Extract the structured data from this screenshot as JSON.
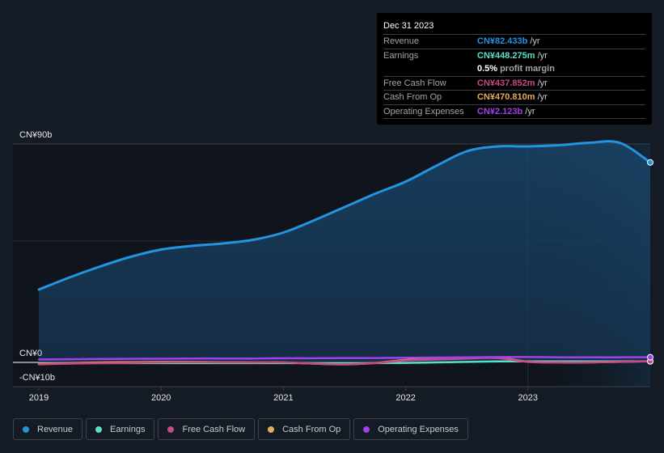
{
  "tooltip": {
    "date": "Dec 31 2023",
    "rows": [
      {
        "label": "Revenue",
        "value": "CN¥82.433b",
        "unit": "/yr",
        "color": "#2394df"
      },
      {
        "label": "Earnings",
        "value": "CN¥448.275m",
        "unit": "/yr",
        "color": "#57e0c8"
      },
      {
        "label": "",
        "value": "0.5%",
        "unit": "profit margin",
        "color": "#ffffff"
      },
      {
        "label": "Free Cash Flow",
        "value": "CN¥437.852m",
        "unit": "/yr",
        "color": "#c8488a"
      },
      {
        "label": "Cash From Op",
        "value": "CN¥470.810m",
        "unit": "/yr",
        "color": "#e8a95c"
      },
      {
        "label": "Operating Expenses",
        "value": "CN¥2.123b",
        "unit": "/yr",
        "color": "#a040ef"
      }
    ]
  },
  "legend": [
    {
      "label": "Revenue",
      "color": "#2394df"
    },
    {
      "label": "Earnings",
      "color": "#57e0c8"
    },
    {
      "label": "Free Cash Flow",
      "color": "#c8488a"
    },
    {
      "label": "Cash From Op",
      "color": "#e8a95c"
    },
    {
      "label": "Operating Expenses",
      "color": "#a040ef"
    }
  ],
  "chart_data": {
    "type": "area",
    "title": "",
    "xlabel": "",
    "ylabel": "",
    "ylim": [
      -10,
      90
    ],
    "xlim": [
      2019.0,
      2024.0
    ],
    "y_ticks": [
      {
        "value": 90,
        "label": "CN¥90b"
      },
      {
        "value": 0,
        "label": "CN¥0"
      },
      {
        "value": -10,
        "label": "-CN¥10b"
      }
    ],
    "x_ticks": [
      {
        "value": 2019,
        "label": "2019"
      },
      {
        "value": 2020,
        "label": "2020"
      },
      {
        "value": 2021,
        "label": "2021"
      },
      {
        "value": 2022,
        "label": "2022"
      },
      {
        "value": 2023,
        "label": "2023"
      }
    ],
    "highlight_from": 2023.0,
    "grid": true,
    "legend_position": "bottom",
    "x": [
      2019.0,
      2019.25,
      2019.5,
      2019.75,
      2020.0,
      2020.25,
      2020.5,
      2020.75,
      2021.0,
      2021.25,
      2021.5,
      2021.75,
      2022.0,
      2022.25,
      2022.5,
      2022.75,
      2023.0,
      2023.25,
      2023.5,
      2023.75,
      2024.0
    ],
    "series": [
      {
        "name": "Revenue",
        "color": "#2394df",
        "values": [
          30.0,
          35.0,
          39.5,
          43.5,
          46.5,
          48.0,
          49.0,
          50.5,
          53.5,
          58.5,
          64.0,
          69.5,
          74.5,
          81.0,
          87.0,
          89.0,
          89.0,
          89.5,
          90.5,
          90.5,
          82.4
        ]
      },
      {
        "name": "Earnings",
        "color": "#57e0c8",
        "values": [
          -0.3,
          -0.3,
          -0.3,
          -0.3,
          -0.3,
          -0.3,
          -0.3,
          -0.3,
          -0.3,
          -0.3,
          -0.3,
          -0.3,
          -0.2,
          0.0,
          0.2,
          0.4,
          0.4,
          0.4,
          0.4,
          0.4,
          0.45
        ]
      },
      {
        "name": "Free Cash Flow",
        "color": "#c8488a",
        "values": [
          -0.8,
          -0.5,
          -0.3,
          -0.2,
          0.0,
          0.1,
          0.0,
          0.0,
          0.0,
          -0.5,
          -0.8,
          -0.3,
          0.8,
          1.2,
          1.6,
          1.8,
          0.2,
          0.0,
          0.0,
          0.2,
          0.44
        ]
      },
      {
        "name": "Cash From Op",
        "color": "#e8a95c",
        "values": [
          -0.5,
          -0.3,
          0.0,
          0.1,
          0.2,
          0.2,
          0.1,
          0.0,
          0.0,
          -0.5,
          -0.8,
          -0.2,
          1.0,
          1.4,
          1.8,
          2.0,
          0.3,
          0.0,
          0.0,
          0.3,
          0.47
        ]
      },
      {
        "name": "Operating Expenses",
        "color": "#a040ef",
        "values": [
          1.2,
          1.3,
          1.4,
          1.5,
          1.5,
          1.6,
          1.6,
          1.6,
          1.7,
          1.7,
          1.8,
          1.8,
          1.9,
          2.0,
          2.1,
          2.2,
          2.2,
          2.1,
          2.1,
          2.1,
          2.12
        ]
      }
    ]
  }
}
